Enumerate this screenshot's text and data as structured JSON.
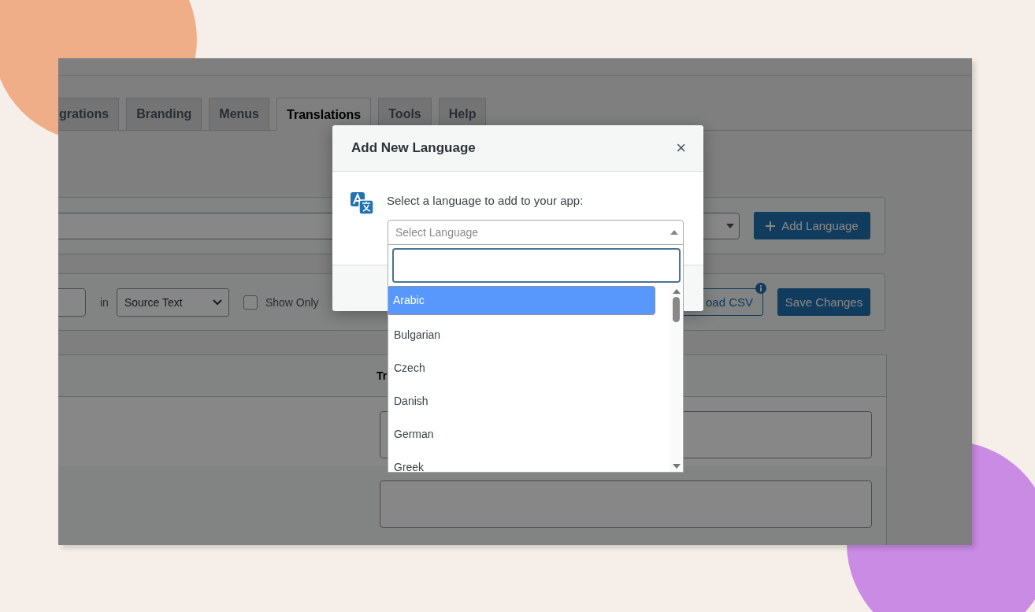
{
  "tabs": [
    {
      "label": "grations",
      "selected": false
    },
    {
      "label": "Branding",
      "selected": false
    },
    {
      "label": "Menus",
      "selected": false
    },
    {
      "label": "Translations",
      "selected": true
    },
    {
      "label": "Tools",
      "selected": false
    },
    {
      "label": "Help",
      "selected": false
    }
  ],
  "language_panel": {
    "add_button": "Add Language"
  },
  "filter_panel": {
    "in_label": "in",
    "field_select": "Source Text",
    "show_only": {
      "label": "Show Only",
      "checked": false
    },
    "upload_button": "oad CSV",
    "save_button": "Save Changes"
  },
  "table": {
    "header": "Tr"
  },
  "modal": {
    "title": "Add New Language",
    "close": "×",
    "prompt": "Select a language to add to your app:",
    "select_placeholder": "Select Language",
    "options": [
      {
        "label": "Arabic",
        "selected": true
      },
      {
        "label": "Bulgarian",
        "selected": false
      },
      {
        "label": "Czech",
        "selected": false
      },
      {
        "label": "Danish",
        "selected": false
      },
      {
        "label": "German",
        "selected": false
      },
      {
        "label": "Greek",
        "selected": false
      }
    ]
  }
}
